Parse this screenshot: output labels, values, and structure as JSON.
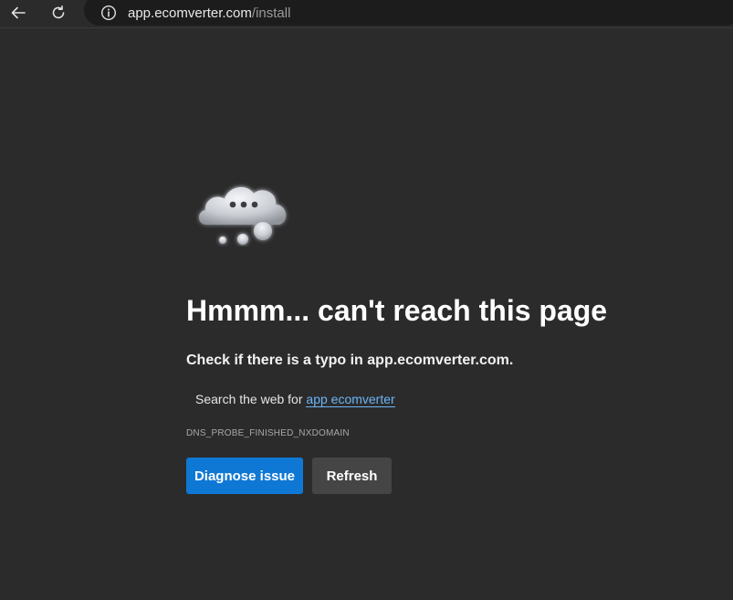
{
  "browser": {
    "address": {
      "domain": "app.ecomverter.com",
      "path": "/install"
    },
    "icons": {
      "back": "back-arrow-icon",
      "refresh": "refresh-icon",
      "site_info": "info-icon"
    }
  },
  "error_page": {
    "illustration": "cloud-icon",
    "headline": "Hmmm... can't reach this page",
    "typo_message": "Check if there is a typo in app.ecomverter.com.",
    "search_prefix": "Search the web for ",
    "search_link": "app ecomverter",
    "error_code": "DNS_PROBE_FINISHED_NXDOMAIN",
    "buttons": {
      "diagnose": "Diagnose issue",
      "refresh": "Refresh"
    },
    "colors": {
      "background": "#2b2b2b",
      "primary_button": "#0f78d4",
      "secondary_button": "#454545",
      "link": "#6cb4f7"
    }
  }
}
